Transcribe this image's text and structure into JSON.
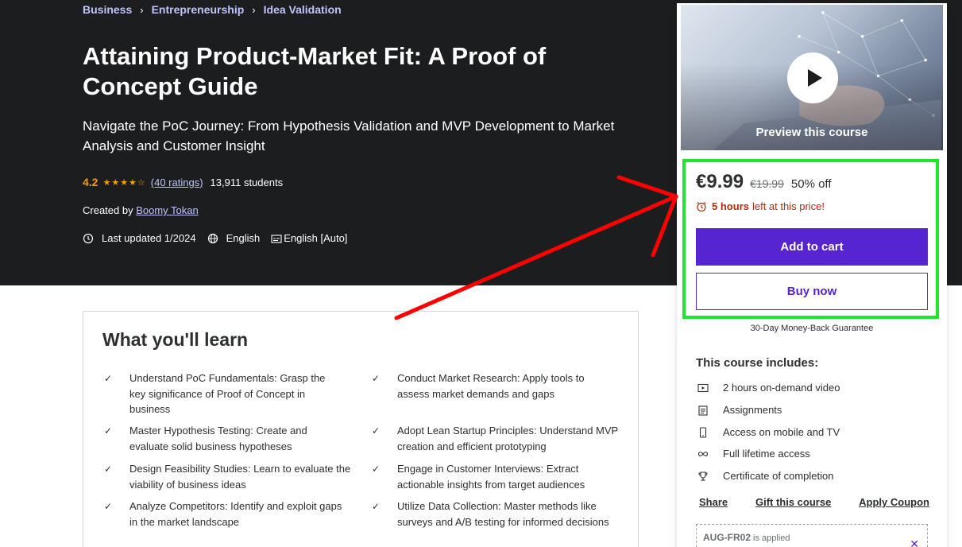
{
  "breadcrumb": [
    "Business",
    "Entrepreneurship",
    "Idea Validation"
  ],
  "course": {
    "title": "Attaining Product-Market Fit: A Proof of Concept Guide",
    "subtitle": "Navigate the PoC Journey: From Hypothesis Validation and MVP Development to Market Analysis and Customer Insight",
    "rating": "4.2",
    "rating_stars": 4.2,
    "ratings_count": "(40 ratings)",
    "students": "13,911 students",
    "created_by_label": "Created by",
    "author": "Boomy Tokan",
    "last_updated": "Last updated 1/2024",
    "language": "English",
    "captions": "English [Auto]"
  },
  "learn": {
    "title": "What you'll learn",
    "items": [
      "Understand PoC Fundamentals: Grasp the key significance of Proof of Concept in business",
      "Conduct Market Research: Apply tools to assess market demands and gaps",
      "Master Hypothesis Testing: Create and evaluate solid business hypotheses",
      "Adopt Lean Startup Principles: Understand MVP creation and efficient prototyping",
      "Design Feasibility Studies: Learn to evaluate the viability of business ideas",
      "Engage in Customer Interviews: Extract actionable insights from target audiences",
      "Analyze Competitors: Identify and exploit gaps in the market landscape",
      "Utilize Data Collection: Master methods like surveys and A/B testing for informed decisions"
    ]
  },
  "sidebar": {
    "preview_label": "Preview this course",
    "price": "€9.99",
    "old_price": "€19.99",
    "discount": "50% off",
    "timer_bold": "5 hours",
    "timer_rest": "left at this price!",
    "add_to_cart": "Add to cart",
    "buy_now": "Buy now",
    "guarantee": "30-Day Money-Back Guarantee",
    "includes_title": "This course includes:",
    "includes": [
      {
        "icon": "video-icon",
        "label": "2 hours on-demand video"
      },
      {
        "icon": "assignment-icon",
        "label": "Assignments"
      },
      {
        "icon": "mobile-icon",
        "label": "Access on mobile and TV"
      },
      {
        "icon": "infinity-icon",
        "label": "Full lifetime access"
      },
      {
        "icon": "trophy-icon",
        "label": "Certificate of completion"
      }
    ],
    "links": [
      "Share",
      "Gift this course",
      "Apply Coupon"
    ],
    "coupon_code": "AUG-FR02",
    "coupon_applied": "is applied"
  },
  "colors": {
    "hero_bg": "#1c1d1f",
    "accent_purple": "#5624d0",
    "link_lavender": "#c0c4fc",
    "star_orange": "#f69c08",
    "timer_red": "#b32d0f",
    "annotation_green": "#1fe62a",
    "annotation_red": "#ff0000"
  }
}
